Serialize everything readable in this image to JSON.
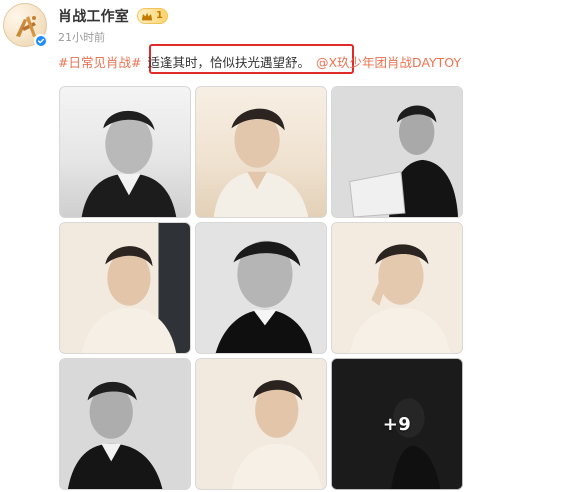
{
  "post": {
    "author": {
      "name": "肖战工作室",
      "vip_level": "1",
      "avatar_char": "战",
      "avatar_icon": "calligraphy-logo-icon",
      "verified_icon": "verified-check-icon",
      "vip_icon": "crown-icon"
    },
    "timestamp": "21小时前",
    "text": {
      "hashtag": "#日常见肖战#",
      "body": "适逢其时，恰似扶光遇望舒。",
      "mention": "@X玖少年团肖战DAYTOY"
    },
    "photos": [
      {
        "label": "photo-1",
        "tone": "bw"
      },
      {
        "label": "photo-2",
        "tone": "warm"
      },
      {
        "label": "photo-3",
        "tone": "bw"
      },
      {
        "label": "photo-4",
        "tone": "warm"
      },
      {
        "label": "photo-5",
        "tone": "bw"
      },
      {
        "label": "photo-6",
        "tone": "warm"
      },
      {
        "label": "photo-7",
        "tone": "bw"
      },
      {
        "label": "photo-8",
        "tone": "warm"
      },
      {
        "label": "photo-9",
        "tone": "dark"
      }
    ],
    "more_photos": "+9"
  },
  "colors": {
    "accent_link": "#eb7350",
    "highlight_border": "#e02a2a",
    "verified_blue": "#1d8cff",
    "vip_gold": "#ffd36b"
  }
}
